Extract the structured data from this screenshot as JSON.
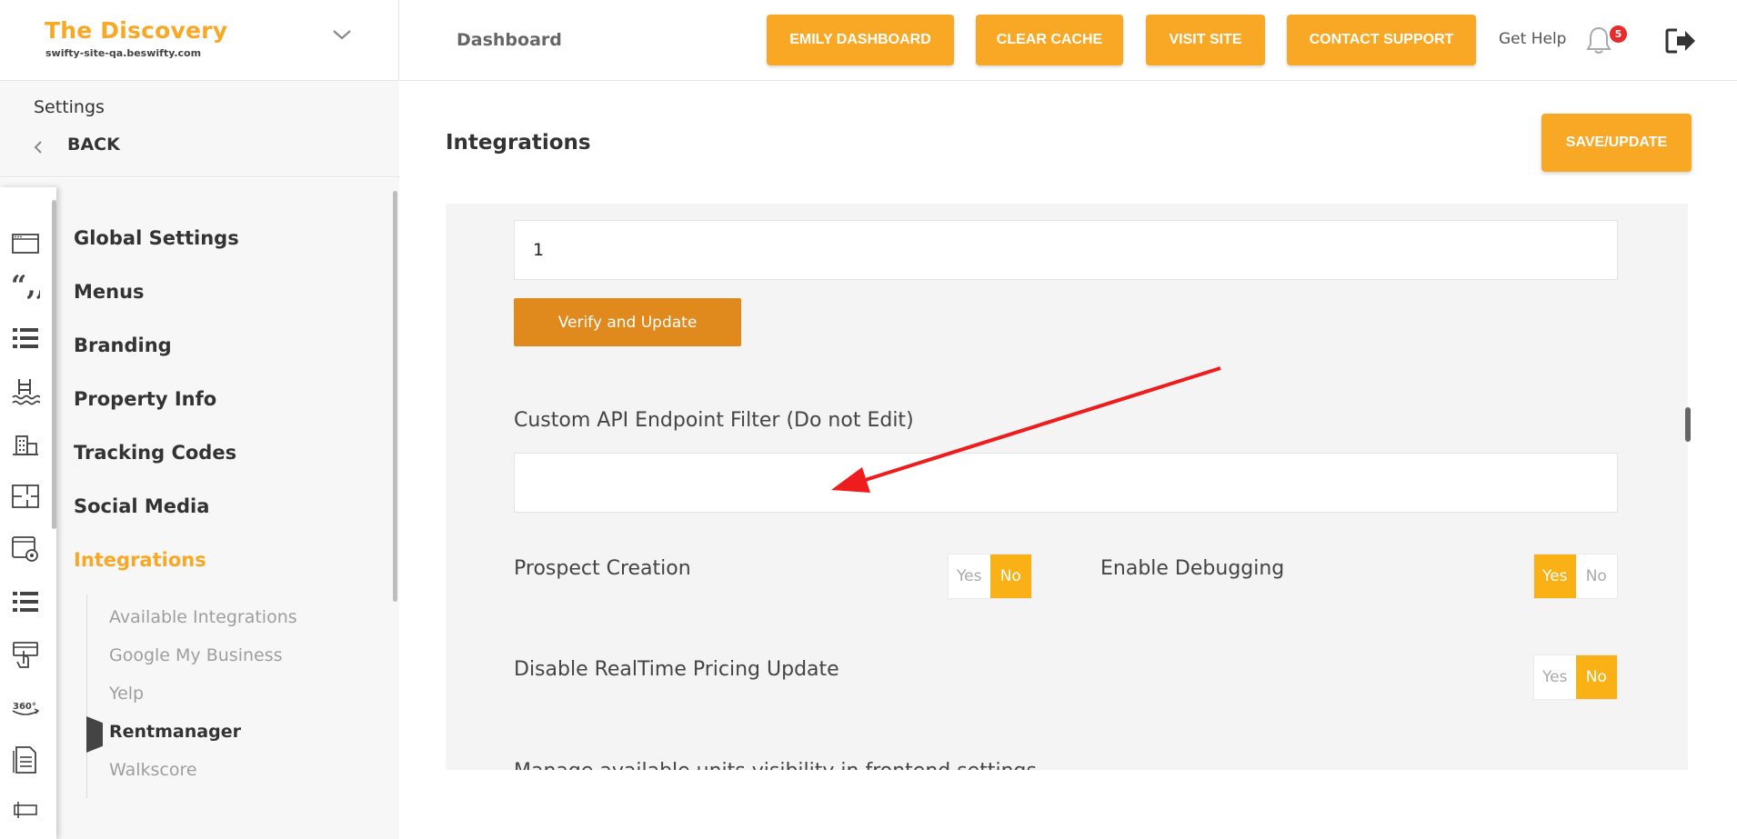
{
  "brand": {
    "title": "The Discovery",
    "subtitle": "swifty-site-qa.beswifty.com"
  },
  "settings": {
    "label": "Settings",
    "back_label": "BACK"
  },
  "nav": {
    "items": [
      {
        "label": "Global Settings"
      },
      {
        "label": "Menus"
      },
      {
        "label": "Branding"
      },
      {
        "label": "Property Info"
      },
      {
        "label": "Tracking Codes"
      },
      {
        "label": "Social Media"
      },
      {
        "label": "Integrations"
      }
    ],
    "sub_items": [
      {
        "label": "Available Integrations"
      },
      {
        "label": "Google My Business"
      },
      {
        "label": "Yelp"
      },
      {
        "label": "Rentmanager"
      },
      {
        "label": "Walkscore"
      }
    ]
  },
  "icons": [
    "browser-window-icon",
    "quote-icon",
    "list-icon",
    "pool-icon",
    "building-icon",
    "floorplan-icon",
    "settings-window-icon",
    "list-icon",
    "touch-screen-icon",
    "360-view-icon",
    "document-icon",
    "sign-icon",
    "chevron-down-icon",
    "chevron-left-icon",
    "bell-icon",
    "logout-icon"
  ],
  "topbar": {
    "dashboard_label": "Dashboard",
    "buttons": [
      "EMILY DASHBOARD",
      "CLEAR CACHE",
      "VISIT SITE",
      "CONTACT SUPPORT"
    ],
    "get_help": "Get Help",
    "notification_count": "5"
  },
  "main": {
    "title": "Integrations",
    "save_label": "SAVE/UPDATE",
    "top_input_value": "1",
    "verify_label": "Verify and Update",
    "custom_api_label": "Custom API Endpoint Filter (Do not Edit)",
    "custom_api_value": "",
    "toggles": {
      "prospect_creation": {
        "label": "Prospect Creation",
        "yes": "Yes",
        "no": "No",
        "selected": "No"
      },
      "enable_debugging": {
        "label": "Enable Debugging",
        "yes": "Yes",
        "no": "No",
        "selected": "Yes"
      },
      "disable_realtime": {
        "label": "Disable RealTime Pricing Update",
        "yes": "Yes",
        "no": "No",
        "selected": "No"
      }
    },
    "cutoff_label": "Manage available units visibility in frontend settings"
  },
  "colors": {
    "accent": "#f9a826",
    "verify_button": "#e08a1e",
    "toggle_on": "#f9b115",
    "badge": "#e52b2b",
    "annotation_arrow": "#ee1c1c"
  }
}
